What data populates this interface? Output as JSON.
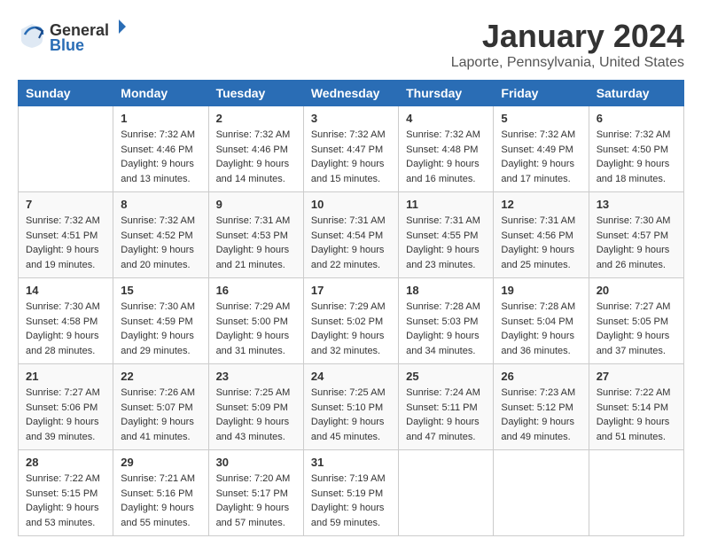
{
  "logo": {
    "text_general": "General",
    "text_blue": "Blue"
  },
  "header": {
    "month_title": "January 2024",
    "location": "Laporte, Pennsylvania, United States"
  },
  "days_of_week": [
    "Sunday",
    "Monday",
    "Tuesday",
    "Wednesday",
    "Thursday",
    "Friday",
    "Saturday"
  ],
  "weeks": [
    [
      {
        "day": "",
        "sunrise": "",
        "sunset": "",
        "daylight": ""
      },
      {
        "day": "1",
        "sunrise": "Sunrise: 7:32 AM",
        "sunset": "Sunset: 4:46 PM",
        "daylight": "Daylight: 9 hours and 13 minutes."
      },
      {
        "day": "2",
        "sunrise": "Sunrise: 7:32 AM",
        "sunset": "Sunset: 4:46 PM",
        "daylight": "Daylight: 9 hours and 14 minutes."
      },
      {
        "day": "3",
        "sunrise": "Sunrise: 7:32 AM",
        "sunset": "Sunset: 4:47 PM",
        "daylight": "Daylight: 9 hours and 15 minutes."
      },
      {
        "day": "4",
        "sunrise": "Sunrise: 7:32 AM",
        "sunset": "Sunset: 4:48 PM",
        "daylight": "Daylight: 9 hours and 16 minutes."
      },
      {
        "day": "5",
        "sunrise": "Sunrise: 7:32 AM",
        "sunset": "Sunset: 4:49 PM",
        "daylight": "Daylight: 9 hours and 17 minutes."
      },
      {
        "day": "6",
        "sunrise": "Sunrise: 7:32 AM",
        "sunset": "Sunset: 4:50 PM",
        "daylight": "Daylight: 9 hours and 18 minutes."
      }
    ],
    [
      {
        "day": "7",
        "sunrise": "Sunrise: 7:32 AM",
        "sunset": "Sunset: 4:51 PM",
        "daylight": "Daylight: 9 hours and 19 minutes."
      },
      {
        "day": "8",
        "sunrise": "Sunrise: 7:32 AM",
        "sunset": "Sunset: 4:52 PM",
        "daylight": "Daylight: 9 hours and 20 minutes."
      },
      {
        "day": "9",
        "sunrise": "Sunrise: 7:31 AM",
        "sunset": "Sunset: 4:53 PM",
        "daylight": "Daylight: 9 hours and 21 minutes."
      },
      {
        "day": "10",
        "sunrise": "Sunrise: 7:31 AM",
        "sunset": "Sunset: 4:54 PM",
        "daylight": "Daylight: 9 hours and 22 minutes."
      },
      {
        "day": "11",
        "sunrise": "Sunrise: 7:31 AM",
        "sunset": "Sunset: 4:55 PM",
        "daylight": "Daylight: 9 hours and 23 minutes."
      },
      {
        "day": "12",
        "sunrise": "Sunrise: 7:31 AM",
        "sunset": "Sunset: 4:56 PM",
        "daylight": "Daylight: 9 hours and 25 minutes."
      },
      {
        "day": "13",
        "sunrise": "Sunrise: 7:30 AM",
        "sunset": "Sunset: 4:57 PM",
        "daylight": "Daylight: 9 hours and 26 minutes."
      }
    ],
    [
      {
        "day": "14",
        "sunrise": "Sunrise: 7:30 AM",
        "sunset": "Sunset: 4:58 PM",
        "daylight": "Daylight: 9 hours and 28 minutes."
      },
      {
        "day": "15",
        "sunrise": "Sunrise: 7:30 AM",
        "sunset": "Sunset: 4:59 PM",
        "daylight": "Daylight: 9 hours and 29 minutes."
      },
      {
        "day": "16",
        "sunrise": "Sunrise: 7:29 AM",
        "sunset": "Sunset: 5:00 PM",
        "daylight": "Daylight: 9 hours and 31 minutes."
      },
      {
        "day": "17",
        "sunrise": "Sunrise: 7:29 AM",
        "sunset": "Sunset: 5:02 PM",
        "daylight": "Daylight: 9 hours and 32 minutes."
      },
      {
        "day": "18",
        "sunrise": "Sunrise: 7:28 AM",
        "sunset": "Sunset: 5:03 PM",
        "daylight": "Daylight: 9 hours and 34 minutes."
      },
      {
        "day": "19",
        "sunrise": "Sunrise: 7:28 AM",
        "sunset": "Sunset: 5:04 PM",
        "daylight": "Daylight: 9 hours and 36 minutes."
      },
      {
        "day": "20",
        "sunrise": "Sunrise: 7:27 AM",
        "sunset": "Sunset: 5:05 PM",
        "daylight": "Daylight: 9 hours and 37 minutes."
      }
    ],
    [
      {
        "day": "21",
        "sunrise": "Sunrise: 7:27 AM",
        "sunset": "Sunset: 5:06 PM",
        "daylight": "Daylight: 9 hours and 39 minutes."
      },
      {
        "day": "22",
        "sunrise": "Sunrise: 7:26 AM",
        "sunset": "Sunset: 5:07 PM",
        "daylight": "Daylight: 9 hours and 41 minutes."
      },
      {
        "day": "23",
        "sunrise": "Sunrise: 7:25 AM",
        "sunset": "Sunset: 5:09 PM",
        "daylight": "Daylight: 9 hours and 43 minutes."
      },
      {
        "day": "24",
        "sunrise": "Sunrise: 7:25 AM",
        "sunset": "Sunset: 5:10 PM",
        "daylight": "Daylight: 9 hours and 45 minutes."
      },
      {
        "day": "25",
        "sunrise": "Sunrise: 7:24 AM",
        "sunset": "Sunset: 5:11 PM",
        "daylight": "Daylight: 9 hours and 47 minutes."
      },
      {
        "day": "26",
        "sunrise": "Sunrise: 7:23 AM",
        "sunset": "Sunset: 5:12 PM",
        "daylight": "Daylight: 9 hours and 49 minutes."
      },
      {
        "day": "27",
        "sunrise": "Sunrise: 7:22 AM",
        "sunset": "Sunset: 5:14 PM",
        "daylight": "Daylight: 9 hours and 51 minutes."
      }
    ],
    [
      {
        "day": "28",
        "sunrise": "Sunrise: 7:22 AM",
        "sunset": "Sunset: 5:15 PM",
        "daylight": "Daylight: 9 hours and 53 minutes."
      },
      {
        "day": "29",
        "sunrise": "Sunrise: 7:21 AM",
        "sunset": "Sunset: 5:16 PM",
        "daylight": "Daylight: 9 hours and 55 minutes."
      },
      {
        "day": "30",
        "sunrise": "Sunrise: 7:20 AM",
        "sunset": "Sunset: 5:17 PM",
        "daylight": "Daylight: 9 hours and 57 minutes."
      },
      {
        "day": "31",
        "sunrise": "Sunrise: 7:19 AM",
        "sunset": "Sunset: 5:19 PM",
        "daylight": "Daylight: 9 hours and 59 minutes."
      },
      {
        "day": "",
        "sunrise": "",
        "sunset": "",
        "daylight": ""
      },
      {
        "day": "",
        "sunrise": "",
        "sunset": "",
        "daylight": ""
      },
      {
        "day": "",
        "sunrise": "",
        "sunset": "",
        "daylight": ""
      }
    ]
  ]
}
